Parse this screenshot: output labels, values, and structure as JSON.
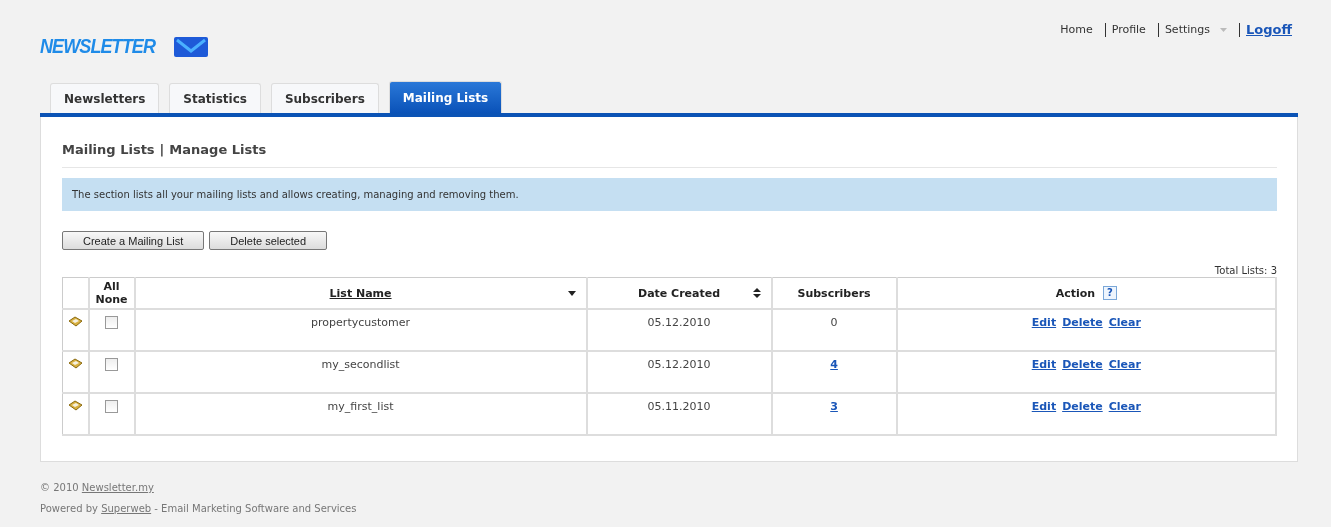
{
  "logo": {
    "text": "NEWSLETTER"
  },
  "top_nav": [
    {
      "label": "Home",
      "kind": "plain"
    },
    {
      "label": "Profile",
      "kind": "plain"
    },
    {
      "label": "Settings",
      "kind": "dropdown"
    },
    {
      "label": "Logoff",
      "kind": "link"
    }
  ],
  "tabs": [
    {
      "label": "Newsletters",
      "selected": false
    },
    {
      "label": "Statistics",
      "selected": false
    },
    {
      "label": "Subscribers",
      "selected": false
    },
    {
      "label": "Mailing Lists",
      "selected": true
    }
  ],
  "breadcrumb": {
    "section": "Mailing Lists",
    "separator": "|",
    "page": "Manage Lists"
  },
  "info": "The section lists all your mailing lists and allows creating, managing and removing them.",
  "buttons": [
    "Create a Mailing List",
    "Delete selected"
  ],
  "total": "Total Lists: 3",
  "table": {
    "columns": [
      {
        "kind": "icon"
      },
      {
        "kind": "select",
        "label": "All",
        "label2": "None"
      },
      {
        "kind": "sort_down",
        "label": "List Name",
        "underlined": true
      },
      {
        "kind": "sort_both",
        "label": "Date Created",
        "underlined": false
      },
      {
        "kind": "plain",
        "label": "Subscribers"
      },
      {
        "kind": "plain",
        "label": "Action",
        "help": "?"
      }
    ],
    "rows": [
      {
        "checked": false,
        "name": "propertycustomer",
        "date": "05.12.2010",
        "subscribers": "0",
        "subscribers_linked": false,
        "actions": [
          "Edit",
          "Delete",
          "Clear"
        ]
      },
      {
        "checked": false,
        "name": "my_secondlist",
        "date": "05.12.2010",
        "subscribers": "4",
        "subscribers_linked": true,
        "actions": [
          "Edit",
          "Delete",
          "Clear"
        ]
      },
      {
        "checked": false,
        "name": "my_first_list",
        "date": "05.11.2010",
        "subscribers": "3",
        "subscribers_linked": true,
        "actions": [
          "Edit",
          "Delete",
          "Clear"
        ]
      }
    ]
  },
  "footer": [
    {
      "before": "© 2010",
      "link": "Newsletter.my"
    },
    {
      "before": "Powered by",
      "link": "Superweb",
      "after": "- Email Marketing Software and Services"
    }
  ]
}
